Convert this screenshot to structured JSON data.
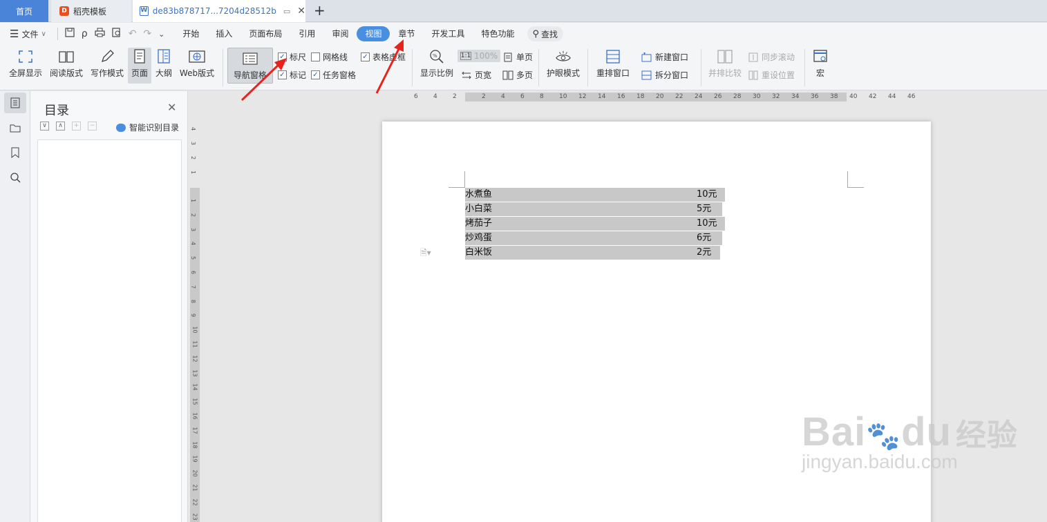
{
  "tabs": {
    "home": "首页",
    "template": "稻壳模板",
    "doc": "de83b878717...7204d28512b",
    "doc_icon": "W",
    "template_icon": "D"
  },
  "menu": {
    "file": "文件",
    "items": [
      "开始",
      "插入",
      "页面布局",
      "引用",
      "审阅",
      "视图",
      "章节",
      "开发工具",
      "特色功能"
    ],
    "active": "视图",
    "search": "查找"
  },
  "ribbon": {
    "fullscreen": "全屏显示",
    "reading": "阅读版式",
    "writing": "写作模式",
    "page": "页面",
    "outline": "大纲",
    "web": "Web版式",
    "nav_pane": "导航窗格",
    "ruler": "标尺",
    "gridlines": "网格线",
    "table_border": "表格虚框",
    "marks": "标记",
    "task_pane": "任务窗格",
    "zoom": "显示比例",
    "zoom_value": "100%",
    "single_page": "单页",
    "page_width": "页宽",
    "multi_page": "多页",
    "eye_mode": "护眼模式",
    "arrange_window": "重排窗口",
    "new_window": "新建窗口",
    "split_window": "拆分窗口",
    "side_by_side": "并排比较",
    "sync_scroll": "同步滚动",
    "reset_position": "重设位置",
    "macro": "宏"
  },
  "toc": {
    "title": "目录",
    "smart": "智能识别目录"
  },
  "ruler": {
    "h_left": [
      "6",
      "4",
      "2"
    ],
    "h_right": [
      "2",
      "4",
      "6",
      "8",
      "10",
      "12",
      "14",
      "16",
      "18",
      "20",
      "22",
      "24",
      "26",
      "28",
      "30",
      "32",
      "34",
      "36",
      "38",
      "40",
      "42",
      "44",
      "46"
    ],
    "v_top": [
      "4",
      "3",
      "2",
      "1"
    ],
    "v_body": [
      "1",
      "2",
      "3",
      "4",
      "5",
      "6",
      "7",
      "8",
      "9",
      "10",
      "11",
      "12",
      "13",
      "14",
      "15",
      "16",
      "17",
      "18",
      "19",
      "20",
      "21",
      "22",
      "23"
    ]
  },
  "document": {
    "rows": [
      {
        "item": "水煮鱼",
        "price": "10元"
      },
      {
        "item": "小白菜",
        "price": "5元"
      },
      {
        "item": "烤茄子",
        "price": "10元"
      },
      {
        "item": "炒鸡蛋",
        "price": "6元"
      },
      {
        "item": "白米饭",
        "price": "2元"
      }
    ]
  },
  "watermark": {
    "brand": "Bai",
    "brand_du": "du",
    "cn": "经验",
    "url": "jingyan.baidu.com"
  },
  "colors": {
    "accent": "#4a8ee0",
    "arrow": "#e8231d",
    "selection": "#c8c8c8"
  }
}
